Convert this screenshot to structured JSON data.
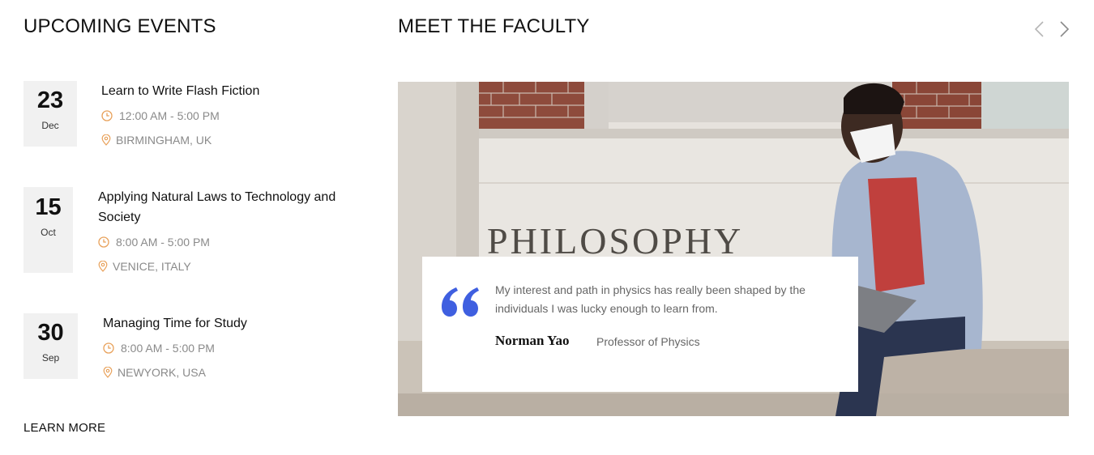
{
  "events_section": {
    "title": "UPCOMING EVENTS",
    "learn_more": "LEARN MORE",
    "items": [
      {
        "day": "23",
        "month": "Dec",
        "title": "Learn to Write Flash Fiction",
        "time": "12:00 AM - 5:00 PM",
        "location": "BIRMINGHAM, UK"
      },
      {
        "day": "15",
        "month": "Oct",
        "title": "Applying Natural Laws to Technology and Society",
        "time": "8:00 AM - 5:00 PM",
        "location": "VENICE, ITALY"
      },
      {
        "day": "30",
        "month": "Sep",
        "title": "Managing Time for Study",
        "time": "8:00 AM - 5:00 PM",
        "location": "NEWYORK, USA"
      }
    ]
  },
  "faculty_section": {
    "title": "MEET THE FACULTY",
    "prev_icon": "chevron-left-icon",
    "next_icon": "chevron-right-icon",
    "photo_sign_text": "PHILOSOPHY",
    "quote": {
      "text": "My interest and path in physics has really been shaped by the individuals I was lucky enough to learn from.",
      "author": "Norman Yao",
      "role": "Professor of Physics"
    }
  },
  "colors": {
    "accent_orange": "#e8a15a",
    "quote_blue": "#3f5fe0",
    "date_box_bg": "#f1f1f1",
    "meta_gray": "#8a8a8a"
  }
}
